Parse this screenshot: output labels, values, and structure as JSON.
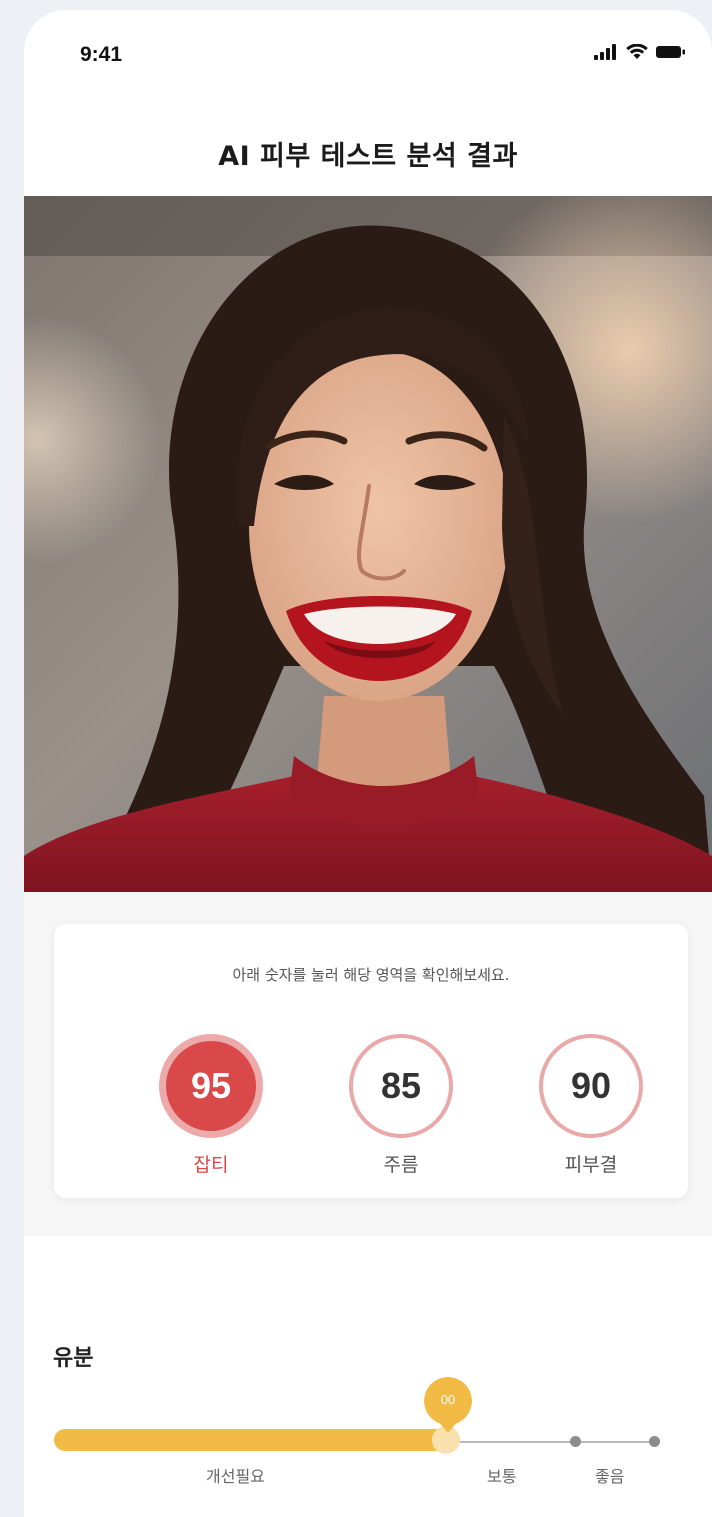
{
  "status_bar": {
    "time": "9:41"
  },
  "header": {
    "title": "AI 피부 테스트 분석 결과"
  },
  "photo": {
    "description_icon": "portrait-photo"
  },
  "scores": {
    "instruction": "아래 숫자를 눌러 해당 영역을 확인해보세요.",
    "items": [
      {
        "value": "95",
        "label": "잡티",
        "active": true
      },
      {
        "value": "85",
        "label": "주름",
        "active": false
      },
      {
        "value": "90",
        "label": "피부결",
        "active": false
      }
    ]
  },
  "oil": {
    "title": "유분",
    "slider_value": "00",
    "slider_fraction": 0.65,
    "levels": [
      "개선필요",
      "보통",
      "좋음"
    ]
  },
  "colors": {
    "accent_red": "#d9494a",
    "accent_red_light": "#ecaaaa",
    "slider_yellow": "#f1bb45"
  }
}
